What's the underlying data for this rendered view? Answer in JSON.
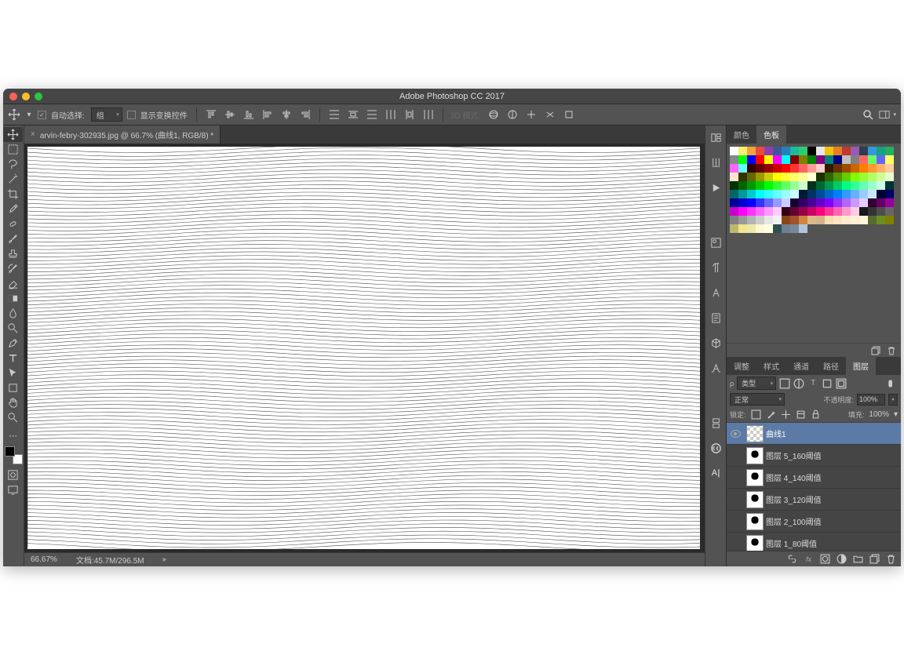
{
  "title": "Adobe Photoshop CC 2017",
  "optbar": {
    "auto_select": "自动选择:",
    "group": "组",
    "show_transform": "显示变换控件",
    "mode3d": "3D 模式:"
  },
  "tab": {
    "close": "×",
    "label": "arvin-febry-302935.jpg @ 66.7% (曲线1, RGB/8) *"
  },
  "status": {
    "zoom": "66.67%",
    "docinfo": "文档:45.7M/296.5M",
    "chev": "▸"
  },
  "color_tabs": {
    "color": "颜色",
    "swatch": "色板"
  },
  "layer_tabs": {
    "adjust": "调整",
    "styles": "样式",
    "channels": "通道",
    "paths": "路径",
    "layers": "图层"
  },
  "layer_filter": {
    "kind": "类型"
  },
  "layer_blend": {
    "mode": "正常",
    "opacity_lbl": "不透明度:",
    "opacity": "100%",
    "fill_lbl": "填充:",
    "fill": "100%"
  },
  "lock": {
    "label": "锁定:"
  },
  "layers": [
    {
      "name": "曲线1",
      "visible": true,
      "sel": true,
      "thumb": "checker"
    },
    {
      "name": "图层 5_160阈值",
      "visible": false,
      "sel": false,
      "thumb": "face"
    },
    {
      "name": "图层 4_140阈值",
      "visible": false,
      "sel": false,
      "thumb": "face"
    },
    {
      "name": "图层 3_120阈值",
      "visible": false,
      "sel": false,
      "thumb": "face"
    },
    {
      "name": "图层 2_100阈值",
      "visible": false,
      "sel": false,
      "thumb": "face"
    },
    {
      "name": "图层 1_80阈值",
      "visible": false,
      "sel": false,
      "thumb": "face"
    }
  ],
  "swatch_colors": [
    "#ffffff",
    "#f5f070",
    "#f2a33c",
    "#e84c3d",
    "#8e3fad",
    "#3b5998",
    "#2880b9",
    "#1abc9c",
    "#2ecc71",
    "#000000",
    "#e8e8e8",
    "#f1c40f",
    "#e67e22",
    "#c0392b",
    "#9b59b6",
    "#2c3e50",
    "#3498db",
    "#16a085",
    "#27ae60",
    "#7f8c8d",
    "#00ff00",
    "#0000ff",
    "#ff0000",
    "#ffff00",
    "#ff00ff",
    "#00ffff",
    "#800000",
    "#808000",
    "#008000",
    "#800080",
    "#008080",
    "#000080",
    "#c0c0c0",
    "#808080",
    "#ff6666",
    "#66ff66",
    "#6666ff",
    "#ffff66",
    "#ff66ff",
    "#66ffff",
    "#330000",
    "#660000",
    "#990000",
    "#cc0000",
    "#ff0000",
    "#ff3333",
    "#ff6666",
    "#ff9999",
    "#ffcccc",
    "#331900",
    "#663300",
    "#994c00",
    "#cc6600",
    "#ff8000",
    "#ff9933",
    "#ffb266",
    "#ffcc99",
    "#ffe5cc",
    "#333300",
    "#666600",
    "#999900",
    "#cccc00",
    "#ffff00",
    "#ffff33",
    "#ffff66",
    "#ffff99",
    "#ffffcc",
    "#193300",
    "#336600",
    "#4c9900",
    "#66cc00",
    "#80ff00",
    "#99ff33",
    "#b2ff66",
    "#ccff99",
    "#e5ffcc",
    "#003300",
    "#006600",
    "#009900",
    "#00cc00",
    "#00ff00",
    "#33ff33",
    "#66ff66",
    "#99ff99",
    "#ccffcc",
    "#003319",
    "#006633",
    "#00994c",
    "#00cc66",
    "#00ff80",
    "#33ff99",
    "#66ffb2",
    "#99ffcc",
    "#ccffe5",
    "#003333",
    "#006666",
    "#009999",
    "#00cccc",
    "#00ffff",
    "#33ffff",
    "#66ffff",
    "#99ffff",
    "#ccffff",
    "#001933",
    "#003366",
    "#004c99",
    "#0066cc",
    "#0080ff",
    "#3399ff",
    "#66b2ff",
    "#99ccff",
    "#cce5ff",
    "#000033",
    "#000066",
    "#000099",
    "#0000cc",
    "#0000ff",
    "#3333ff",
    "#6666ff",
    "#9999ff",
    "#ccccff",
    "#190033",
    "#330066",
    "#4c0099",
    "#6600cc",
    "#8000ff",
    "#9933ff",
    "#b266ff",
    "#cc99ff",
    "#e5ccff",
    "#330033",
    "#660066",
    "#990099",
    "#cc00cc",
    "#ff00ff",
    "#ff33ff",
    "#ff66ff",
    "#ff99ff",
    "#ffccff",
    "#330019",
    "#660033",
    "#99004c",
    "#cc0066",
    "#ff0080",
    "#ff3399",
    "#ff66b2",
    "#ff99cc",
    "#ffcce5",
    "#1a1a1a",
    "#333333",
    "#4d4d4d",
    "#666666",
    "#808080",
    "#999999",
    "#b3b3b3",
    "#cccccc",
    "#e6e6e6",
    "#f2f2f2",
    "#8b4513",
    "#a0522d",
    "#cd853f",
    "#deb887",
    "#d2b48c",
    "#f5deb3",
    "#ffe4c4",
    "#ffebcd",
    "#ffefd5",
    "#fff8dc",
    "#556b2f",
    "#6b8e23",
    "#808000",
    "#bdb76b",
    "#f0e68c",
    "#eee8aa",
    "#fafad2",
    "#ffffe0",
    "#2f4f4f",
    "#708090",
    "#778899",
    "#b0c4de"
  ]
}
